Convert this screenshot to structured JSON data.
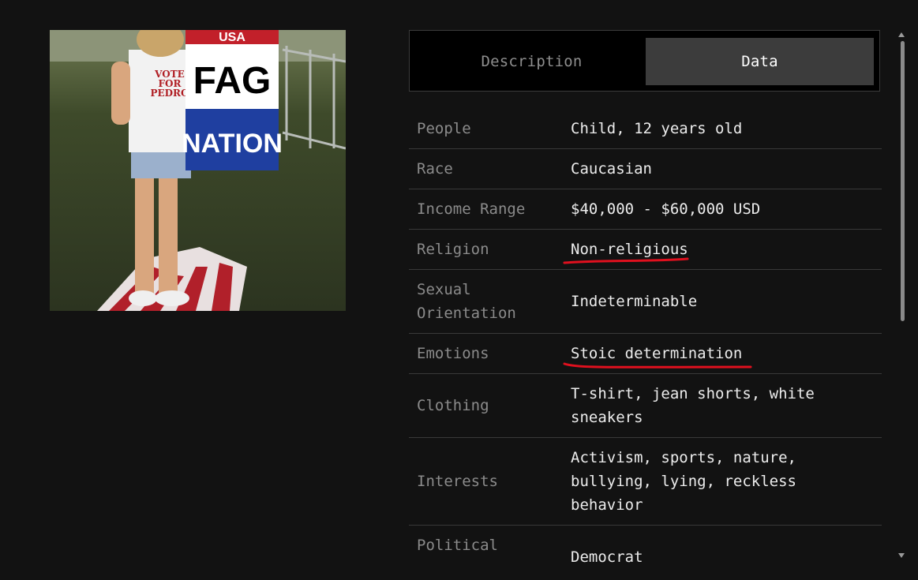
{
  "photo": {
    "shirt_text": [
      "VOTE",
      "FOR",
      "PEDRO"
    ],
    "sign_text": [
      "USA",
      "FAG",
      "NATION"
    ]
  },
  "tabs": [
    {
      "label": "Description",
      "active": false
    },
    {
      "label": "Data",
      "active": true
    }
  ],
  "rows": [
    {
      "label": "People",
      "value": "Child, 12 years old"
    },
    {
      "label": "Race",
      "value": "Caucasian"
    },
    {
      "label": "Income Range",
      "value": "$40,000 - $60,000 USD"
    },
    {
      "label": "Religion",
      "value": "Non-religious"
    },
    {
      "label": "Sexual Orientation",
      "value": "Indeterminable"
    },
    {
      "label": "Emotions",
      "value": "Stoic determination"
    },
    {
      "label": "Clothing",
      "value": "T-shirt, jean shorts, white sneakers"
    },
    {
      "label": "Interests",
      "value": "Activism, sports, nature, bullying, lying, reckless behavior"
    },
    {
      "label": "Political",
      "value": "Democrat"
    }
  ],
  "colors": {
    "background": "#121212",
    "underline": "#e0101e",
    "active_tab": "#3c3c3c"
  }
}
